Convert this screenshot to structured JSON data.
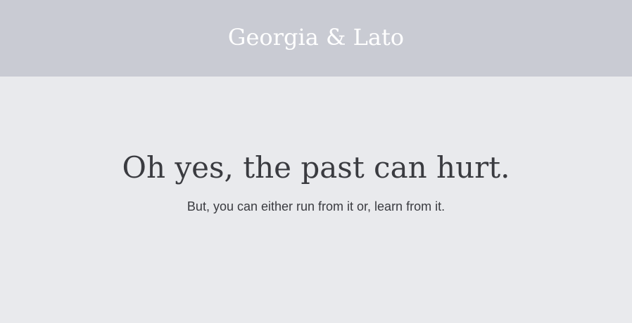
{
  "header": {
    "title": "Georgia & Lato"
  },
  "main": {
    "headline": "Oh yes, the past can hurt.",
    "subline": "But, you can either run from it or, learn from it."
  },
  "colors": {
    "header_bg": "#c9cbd3",
    "page_bg": "#e9eaed",
    "header_text": "#ffffff",
    "body_text": "#3a3b40"
  }
}
